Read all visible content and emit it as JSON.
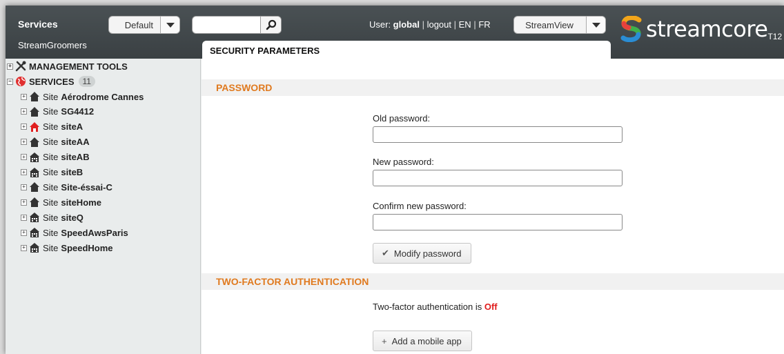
{
  "topbar": {
    "services_label": "Services",
    "subtitle": "StreamGroomers",
    "default_dropdown": "Default",
    "search_placeholder": "",
    "user_prefix": "User: ",
    "user_name": "global",
    "logout": "logout",
    "lang_en": "EN",
    "lang_fr": "FR",
    "view_dropdown": "StreamView",
    "logo_text": "streamcore",
    "logo_version": "T12"
  },
  "sidebar": {
    "management_tools": "MANAGEMENT TOOLS",
    "services": "SERVICES",
    "services_count": "11",
    "site_prefix": "Site",
    "sites": [
      {
        "name": "Aérodrome Cannes",
        "icon": "house-icon"
      },
      {
        "name": "SG4412",
        "icon": "house-icon"
      },
      {
        "name": "siteA",
        "icon": "house-alert-icon"
      },
      {
        "name": "siteAA",
        "icon": "house-icon"
      },
      {
        "name": "siteAB",
        "icon": "building-icon"
      },
      {
        "name": "siteB",
        "icon": "building-icon"
      },
      {
        "name": "Site-éssai-C",
        "icon": "house-icon"
      },
      {
        "name": "siteHome",
        "icon": "house-icon"
      },
      {
        "name": "siteQ",
        "icon": "building-icon"
      },
      {
        "name": "SpeedAwsParis",
        "icon": "building-icon"
      },
      {
        "name": "SpeedHome",
        "icon": "building-icon"
      }
    ]
  },
  "main": {
    "tab_title": "SECURITY PARAMETERS",
    "password_section": "PASSWORD",
    "old_password_label": "Old password:",
    "new_password_label": "New password:",
    "confirm_password_label": "Confirm new password:",
    "modify_button": "Modify password",
    "twofa_section": "TWO-FACTOR AUTHENTICATION",
    "twofa_text": "Two-factor authentication is ",
    "twofa_state": "Off",
    "add_app_button": "Add a mobile app"
  },
  "colors": {
    "topbar": "#3f4548",
    "accent_orange": "#e07a1f",
    "off_red": "#e01b1b",
    "sidebar_bg": "#e9ecec"
  }
}
